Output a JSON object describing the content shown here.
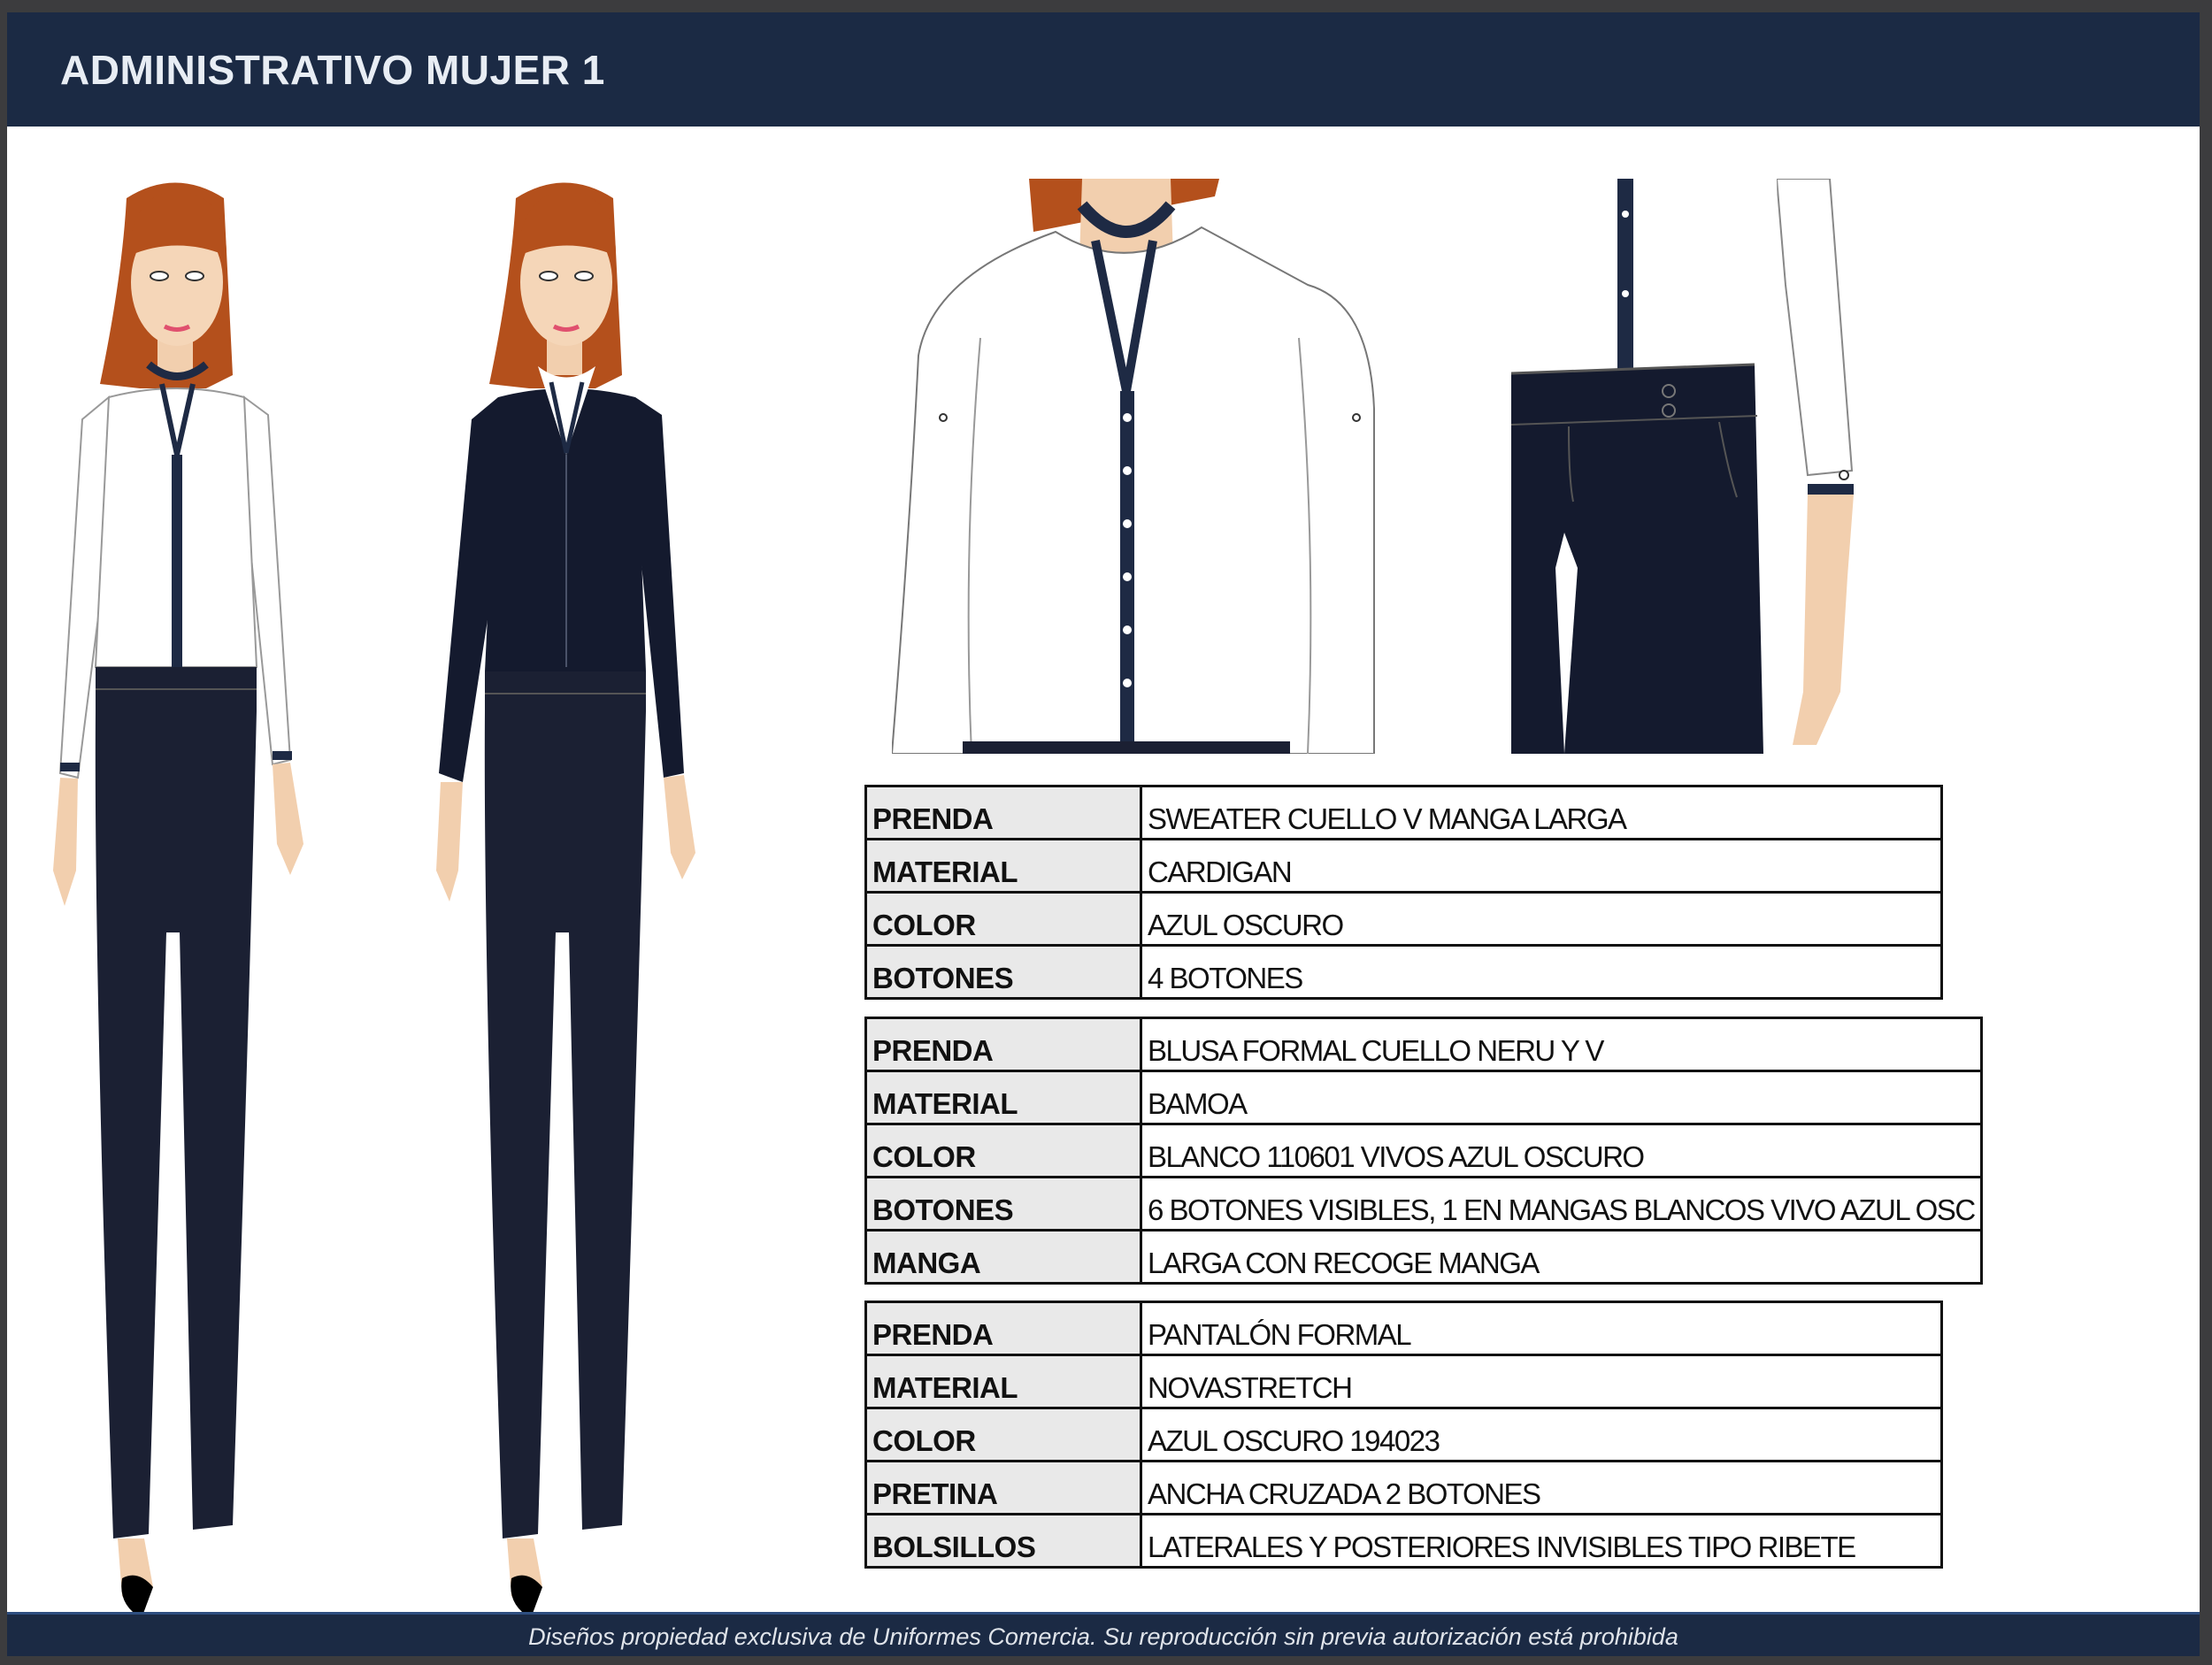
{
  "header": {
    "title": "ADMINISTRATIVO MUJER 1"
  },
  "footer": {
    "notice": "Diseños propiedad exclusiva de Uniformes Comercia. Su reproducción sin previa autorización está prohibida"
  },
  "colors": {
    "navy": "#1b2a44",
    "garment_navy": "#141a2e",
    "hair": "#b4501c",
    "skin": "#f2cfae",
    "white": "#ffffff"
  },
  "figures": [
    {
      "name": "model-white-blouse-icon"
    },
    {
      "name": "model-navy-cardigan-icon"
    },
    {
      "name": "blouse-detail-icon"
    },
    {
      "name": "pants-waistband-detail-icon"
    }
  ],
  "tables": [
    {
      "rows": [
        {
          "label": "PRENDA",
          "value": "SWEATER CUELLO V MANGA LARGA"
        },
        {
          "label": "MATERIAL",
          "value": "CARDIGAN"
        },
        {
          "label": "COLOR",
          "value": "AZUL OSCURO"
        },
        {
          "label": "BOTONES",
          "value": "4 BOTONES"
        }
      ]
    },
    {
      "rows": [
        {
          "label": "PRENDA",
          "value": "BLUSA FORMAL CUELLO NERU Y V"
        },
        {
          "label": "MATERIAL",
          "value": "BAMOA"
        },
        {
          "label": "COLOR",
          "value": "BLANCO 110601 VIVOS AZUL OSCURO"
        },
        {
          "label": "BOTONES",
          "value": "6 BOTONES VISIBLES, 1 EN MANGAS BLANCOS VIVO AZUL OSC"
        },
        {
          "label": "MANGA",
          "value": "LARGA CON RECOGE MANGA"
        }
      ]
    },
    {
      "rows": [
        {
          "label": "PRENDA",
          "value": "PANTALÓN FORMAL"
        },
        {
          "label": "MATERIAL",
          "value": "NOVASTRETCH"
        },
        {
          "label": "COLOR",
          "value": "AZUL OSCURO 194023"
        },
        {
          "label": "PRETINA",
          "value": "ANCHA CRUZADA 2 BOTONES"
        },
        {
          "label": "BOLSILLOS",
          "value": "LATERALES Y POSTERIORES INVISIBLES TIPO RIBETE"
        }
      ]
    }
  ]
}
